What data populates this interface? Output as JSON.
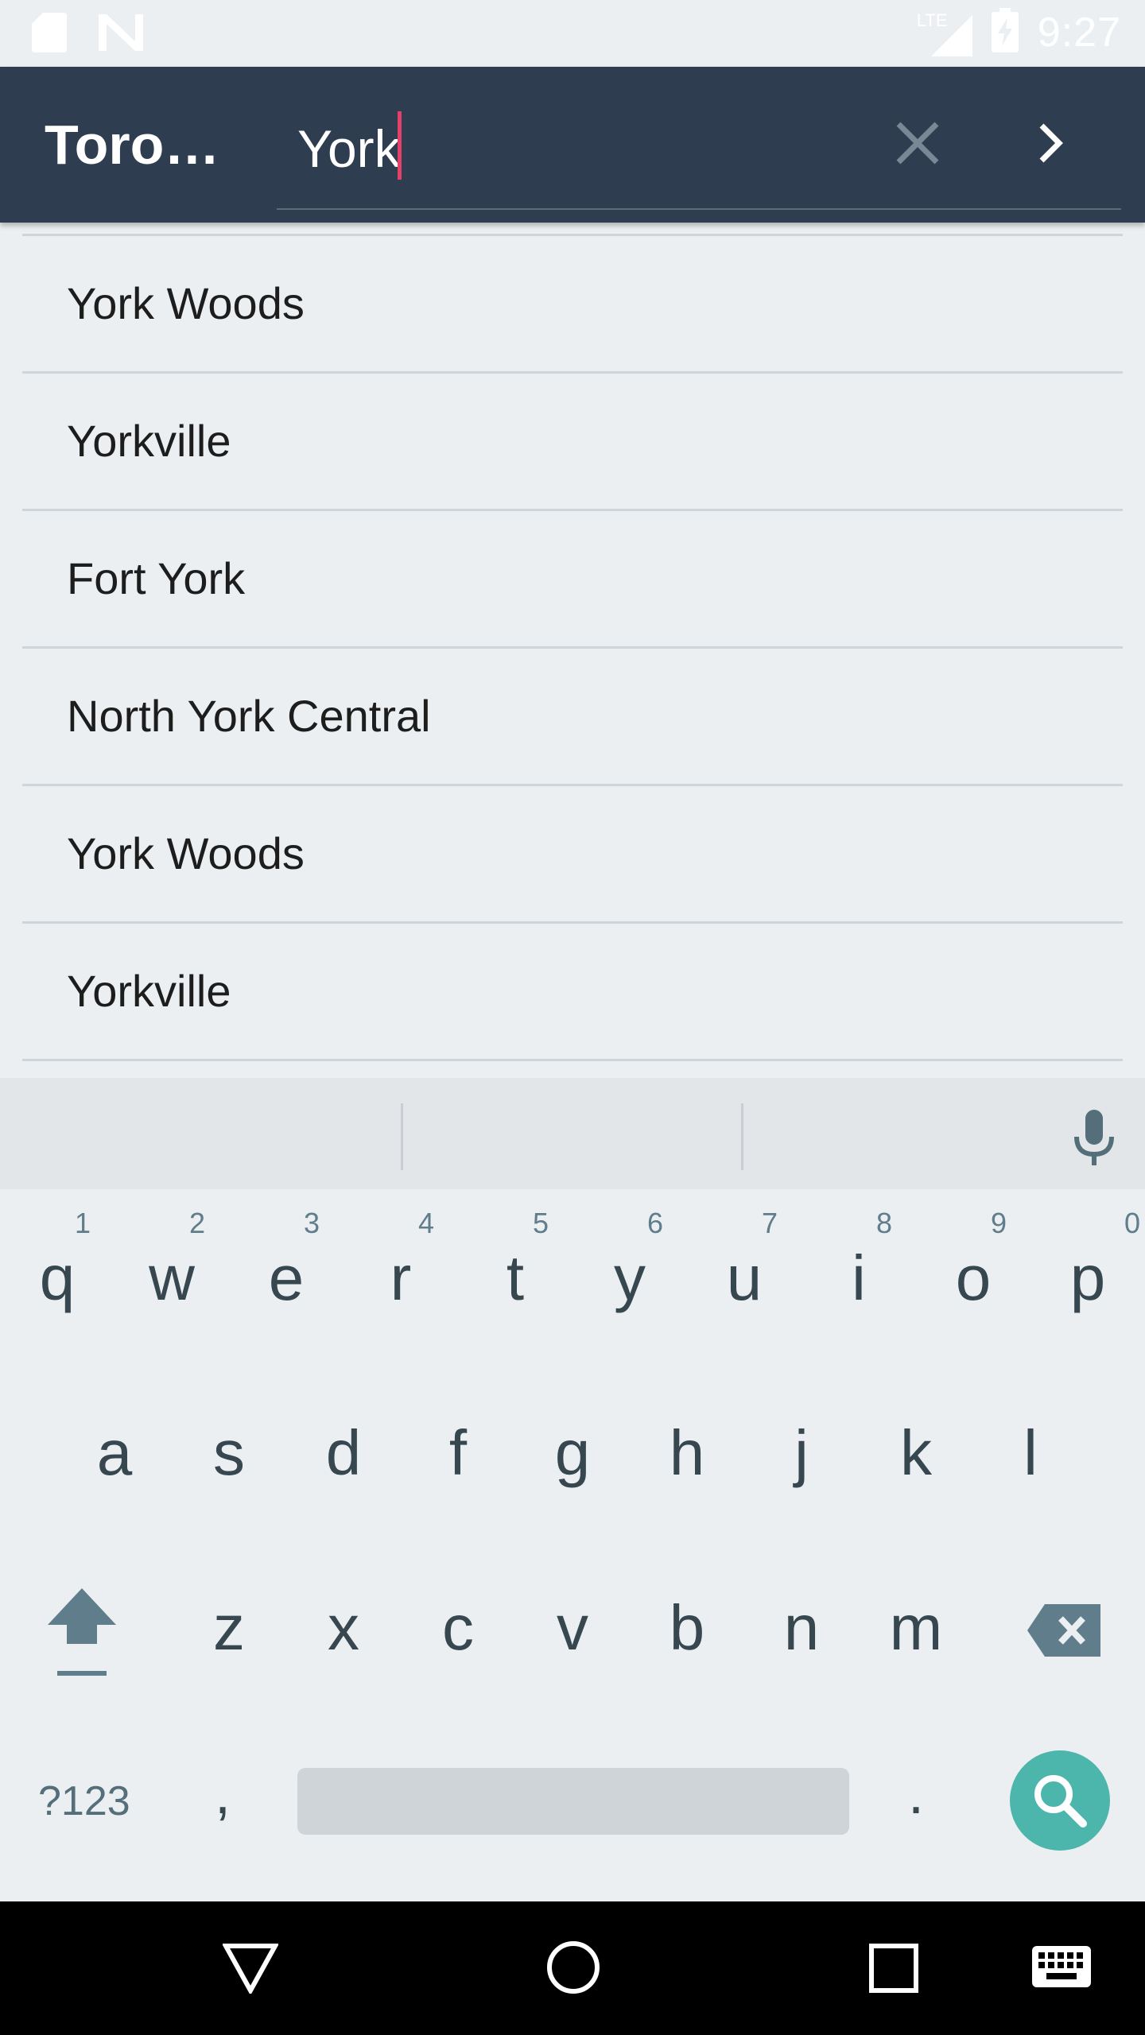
{
  "status_bar": {
    "time": "9:27",
    "network": "LTE",
    "left_icons": [
      "sd-card-icon",
      "n-notification-icon"
    ],
    "right_icons": [
      "signal-icon",
      "battery-charging-icon"
    ]
  },
  "app_bar": {
    "title": "Toron…",
    "search": {
      "value": "York",
      "placeholder": ""
    },
    "clear_icon": "close-icon",
    "go_icon": "chevron-right-icon"
  },
  "results": [
    "York Woods",
    "Yorkville",
    "Fort York",
    "North York Central",
    "York Woods",
    "Yorkville"
  ],
  "keyboard": {
    "row1": [
      {
        "char": "q",
        "num": "1"
      },
      {
        "char": "w",
        "num": "2"
      },
      {
        "char": "e",
        "num": "3"
      },
      {
        "char": "r",
        "num": "4"
      },
      {
        "char": "t",
        "num": "5"
      },
      {
        "char": "y",
        "num": "6"
      },
      {
        "char": "u",
        "num": "7"
      },
      {
        "char": "i",
        "num": "8"
      },
      {
        "char": "o",
        "num": "9"
      },
      {
        "char": "p",
        "num": "0"
      }
    ],
    "row2": [
      "a",
      "s",
      "d",
      "f",
      "g",
      "h",
      "j",
      "k",
      "l"
    ],
    "row3": [
      "z",
      "x",
      "c",
      "v",
      "b",
      "n",
      "m"
    ],
    "symbols_label": "?123",
    "comma": ",",
    "period": "."
  },
  "colors": {
    "app_bar": "#2e3e50",
    "cursor": "#e4406a",
    "search_key": "#4db6ac",
    "background": "#eceff1"
  }
}
